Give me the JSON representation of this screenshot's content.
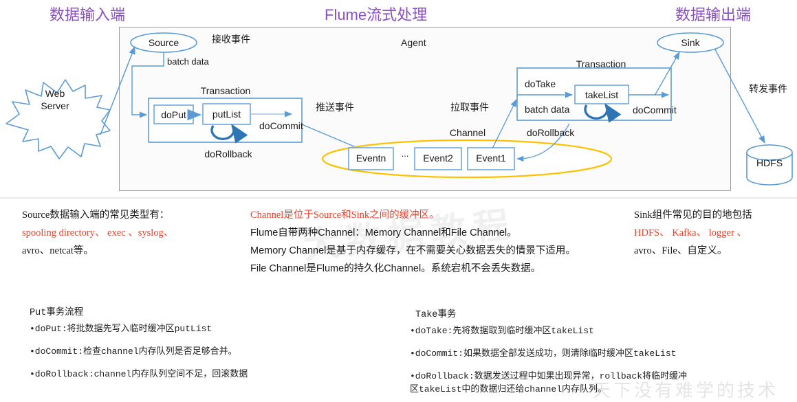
{
  "titles": {
    "left": "数据输入端",
    "middle": "Flume流式处理",
    "right": "数据输出端",
    "color": "#8a4fc4"
  },
  "diagram": {
    "agent_label": "Agent",
    "web_server": "Web\nServer",
    "web_server_line1": "Web",
    "web_server_line2": "Server",
    "source": "Source",
    "sink": "Sink",
    "hdfs": "HDFS",
    "channel_label": "Channel",
    "events": [
      "Eventn",
      "Event2",
      "Event1"
    ],
    "events_ellipsis": "...",
    "flow_labels": {
      "receive_event": "接收事件",
      "batch_data_left": "batch data",
      "push_event": "推送事件",
      "pull_event": "拉取事件",
      "forward_event": "转发事件"
    },
    "left_transaction": {
      "title": "Transaction",
      "do_put": "doPut",
      "put_list": "putList",
      "do_commit": "doCommit",
      "do_rollback": "doRollback"
    },
    "right_transaction": {
      "title": "Transaction",
      "do_take": "doTake",
      "batch_data": "batch data",
      "take_list": "takeList",
      "do_commit": "doCommit",
      "do_rollback": "doRollback"
    },
    "colors": {
      "shape_stroke": "#5b9bd5",
      "channel_stroke": "#ffc000",
      "agent_border": "#9a9a9a",
      "arrow": "#5b9bd5",
      "loop_arrow": "#2e75b6"
    }
  },
  "notes": {
    "left": {
      "line1": "Source数据输入端的常见类型有：",
      "line2_red": "spooling directory、 exec 、syslog、",
      "line3": "avro、netcat等。"
    },
    "middle": {
      "line1_red": "Channel是位于Source和Sink之间的缓冲区。",
      "line2": "Flume自带两种Channel：Memory Channel和File Channel。",
      "line3": "Memory Channel是基于内存缓存，在不需要关心数据丢失的情景下适用。",
      "line4": "File Channel是Flume的持久化Channel。系统宕机不会丢失数据。"
    },
    "right": {
      "line1": "Sink组件常见的目的地包括",
      "line2_red": "HDFS、 Kafka、 logger 、",
      "line3": "avro、File、自定义。"
    }
  },
  "transactions": {
    "put": {
      "heading": "Put事务流程",
      "items": [
        "•doPut:将批数据先写入临时缓冲区putList",
        "•doCommit:检查channel内存队列是否足够合并。",
        "•doRollback:channel内存队列空间不足，回滚数据"
      ]
    },
    "take": {
      "heading": "Take事务",
      "items": [
        "•doTake:先将数据取到临时缓冲区takeList",
        "•doCommit:如果数据全部发送成功，则清除临时缓冲区takeList",
        "•doRollback:数据发送过程中如果出现异常，rollback将临时缓冲",
        "区takeList中的数据归还给channel内存队列。"
      ]
    }
  },
  "watermarks": {
    "center": "大数据教程",
    "bottom": "天下没有难学的技术"
  }
}
